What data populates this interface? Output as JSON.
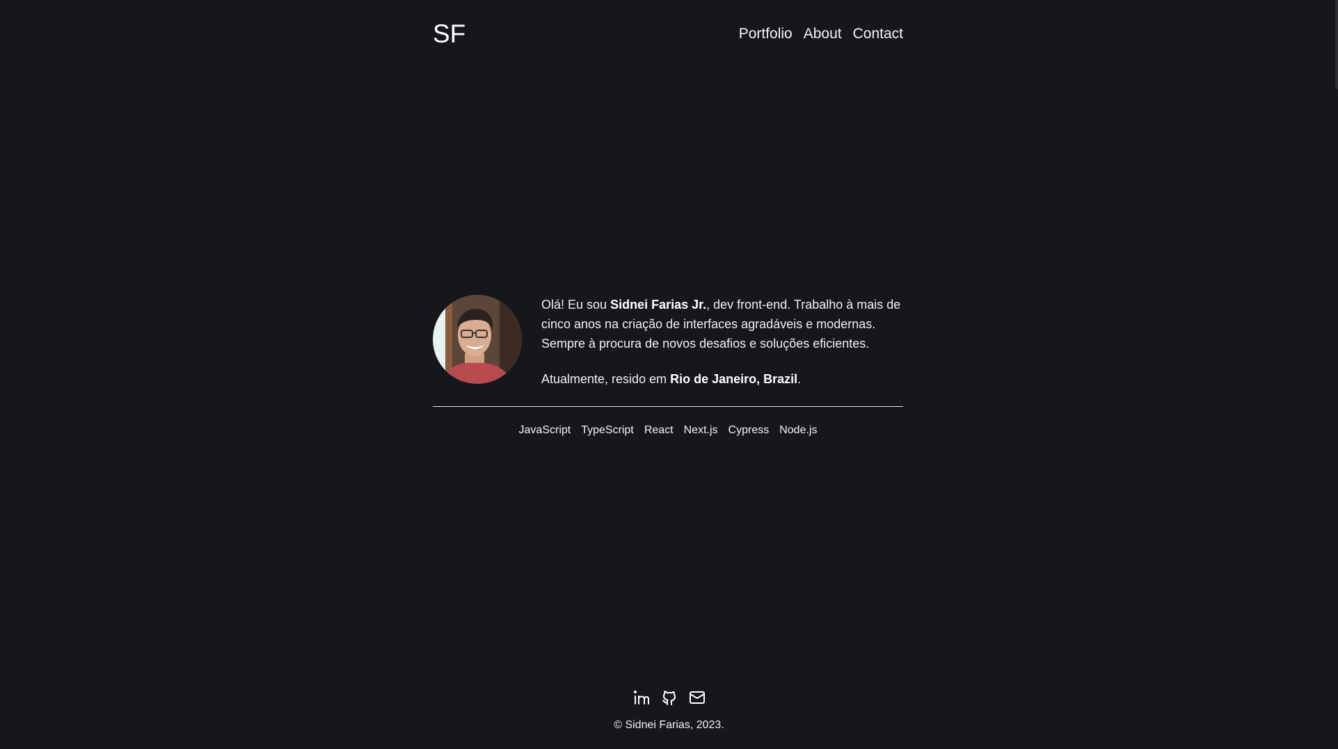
{
  "header": {
    "logo": "SF",
    "nav": [
      {
        "label": "Portfolio"
      },
      {
        "label": "About"
      },
      {
        "label": "Contact"
      }
    ]
  },
  "intro": {
    "p1_a": "Olá! Eu sou ",
    "p1_name": "Sidnei Farias Jr.",
    "p1_b": ", dev front-end. Trabalho à mais de cinco anos na criação de interfaces agradáveis e modernas. Sempre à procura de novos desafios e soluções eficientes.",
    "p2_a": "Atualmente, resido em ",
    "p2_location": "Rio de Janeiro, Brazil",
    "p2_b": "."
  },
  "skills": [
    "JavaScript",
    "TypeScript",
    "React",
    "Next.js",
    "Cypress",
    "Node.js"
  ],
  "footer": {
    "icons": [
      "linkedin-icon",
      "github-icon",
      "mail-icon"
    ],
    "copyright": "© Sidnei Farias, 2023."
  },
  "colors": {
    "background": "#15171c",
    "text": "#f4f4f4",
    "divider": "#e6e6e6"
  }
}
